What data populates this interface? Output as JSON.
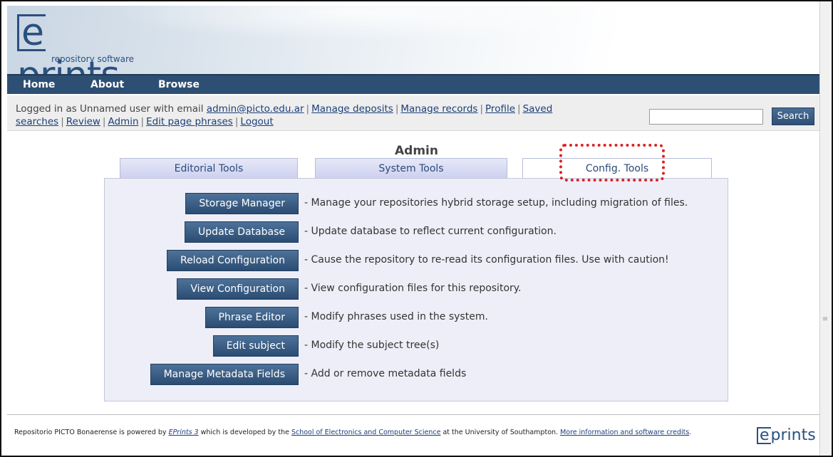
{
  "header": {
    "logo_word": "prints",
    "logo_e": "e",
    "logo_sub": "repository software"
  },
  "menu": {
    "items": [
      {
        "label": "Home"
      },
      {
        "label": "About"
      },
      {
        "label": "Browse"
      }
    ]
  },
  "login": {
    "prefix": "Logged in as Unnamed user with email",
    "email": "admin@picto.edu.ar",
    "links": [
      {
        "label": "Manage deposits"
      },
      {
        "label": "Manage records"
      },
      {
        "label": "Profile"
      },
      {
        "label": "Saved searches"
      },
      {
        "label": "Review"
      },
      {
        "label": "Admin"
      },
      {
        "label": "Edit page phrases"
      },
      {
        "label": "Logout"
      }
    ],
    "search_value": "",
    "search_button": "Search"
  },
  "page": {
    "title": "Admin",
    "tabs": [
      {
        "label": "Editorial Tools",
        "active": false
      },
      {
        "label": "System Tools",
        "active": false
      },
      {
        "label": "Config. Tools",
        "active": true
      }
    ],
    "tools": [
      {
        "label": "Storage Manager",
        "desc": "- Manage your repositories hybrid storage setup, including migration of files."
      },
      {
        "label": "Update Database",
        "desc": "- Update database to reflect current configuration."
      },
      {
        "label": "Reload Configuration",
        "desc": "- Cause the repository to re-read its configuration files. Use with caution!"
      },
      {
        "label": "View Configuration",
        "desc": "- View configuration files for this repository."
      },
      {
        "label": "Phrase Editor",
        "desc": "- Modify phrases used in the system."
      },
      {
        "label": "Edit subject",
        "desc": "- Modify the subject tree(s)"
      },
      {
        "label": "Manage Metadata Fields",
        "desc": "- Add or remove metadata fields"
      }
    ]
  },
  "footer": {
    "t1": "Repositorio PICTO Bonaerense is powered by ",
    "link1": "EPrints 3",
    "t2": " which is developed by the ",
    "link2": "School of Electronics and Computer Science",
    "t3": " at the University of Southampton. ",
    "link3": "More information and software credits",
    "t4": ".",
    "logo_e": "e",
    "logo_word": "prints"
  },
  "colors": {
    "menubar": "#2e4f74",
    "button": "#2b4c72",
    "panel": "#eeeef8",
    "highlight": "#e02020",
    "link": "#1a3f7a"
  }
}
